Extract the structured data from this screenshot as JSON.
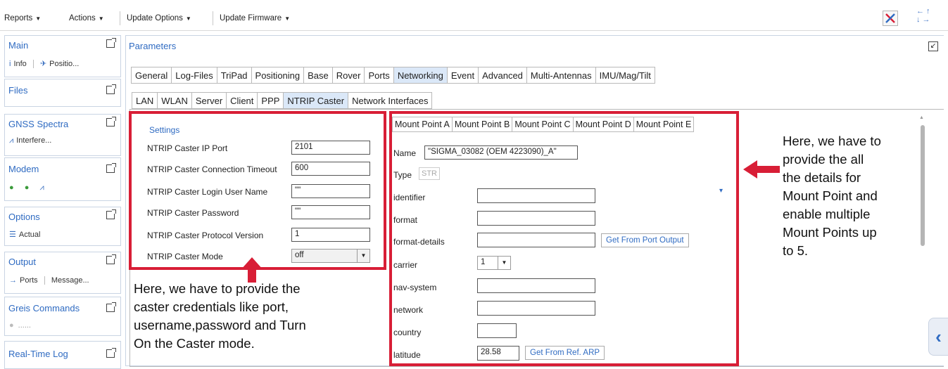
{
  "toolbar": {
    "reports": "Reports",
    "actions": "Actions",
    "update_options": "Update Options",
    "update_firmware": "Update Firmware"
  },
  "sidebar": {
    "main": {
      "title": "Main",
      "items": [
        "Info",
        "Positio..."
      ]
    },
    "files": {
      "title": "Files"
    },
    "gnss": {
      "title": "GNSS Spectra",
      "item": "Interfere..."
    },
    "modem": {
      "title": "Modem"
    },
    "options": {
      "title": "Options",
      "item": "Actual"
    },
    "output": {
      "title": "Output",
      "items": [
        "Ports",
        "Message..."
      ]
    },
    "greis": {
      "title": "Greis Commands",
      "item": "......"
    },
    "realtime": {
      "title": "Real-Time Log"
    }
  },
  "parameters": {
    "title": "Parameters",
    "tabs": [
      "General",
      "Log-Files",
      "TriPad",
      "Positioning",
      "Base",
      "Rover",
      "Ports",
      "Networking",
      "Event",
      "Advanced",
      "Multi-Antennas",
      "IMU/Mag/Tilt"
    ],
    "active_tab": "Networking",
    "subtabs": [
      "LAN",
      "WLAN",
      "Server",
      "Client",
      "PPP",
      "NTRIP Caster",
      "Network Interfaces"
    ],
    "active_subtab": "NTRIP Caster"
  },
  "settings": {
    "title": "Settings",
    "fields": [
      {
        "label": "NTRIP Caster IP Port",
        "value": "2101"
      },
      {
        "label": "NTRIP Caster Connection Timeout",
        "value": "600"
      },
      {
        "label": "NTRIP Caster Login User Name",
        "value": "\"\""
      },
      {
        "label": "NTRIP Caster Password",
        "value": "\"\""
      },
      {
        "label": "NTRIP Caster Protocol Version",
        "value": "1"
      }
    ],
    "mode": {
      "label": "NTRIP Caster Mode",
      "value": "off"
    }
  },
  "mountpoint": {
    "tabs": [
      "Mount Point A",
      "Mount Point B",
      "Mount Point C",
      "Mount Point D",
      "Mount Point E"
    ],
    "active_tab": "Mount Point A",
    "name_label": "Name",
    "name_value": "\"SIGMA_03082 (OEM 4223090)_A\"",
    "type_label": "Type",
    "type_value": "STR",
    "identifier_label": "identifier",
    "format_label": "format",
    "format_details_label": "format-details",
    "get_from_port": "Get From Port Output",
    "carrier_label": "carrier",
    "carrier_value": "1",
    "nav_system_label": "nav-system",
    "network_label": "network",
    "country_label": "country",
    "latitude_label": "latitude",
    "latitude_value": "28.58",
    "get_from_arp": "Get From Ref. ARP"
  },
  "annotations": {
    "left_lines": [
      "Here, we have to provide the",
      "caster credentials like port,",
      "username,password and Turn",
      "On the Caster mode."
    ],
    "right_lines": [
      "Here, we have to",
      "provide the all",
      "the details for",
      "Mount Point and",
      "enable multiple",
      "Mount Points up",
      "to 5."
    ]
  },
  "colors": {
    "accent": "#2f6bc2",
    "highlight": "#d81e36",
    "active_tab": "#dbe8f8"
  }
}
